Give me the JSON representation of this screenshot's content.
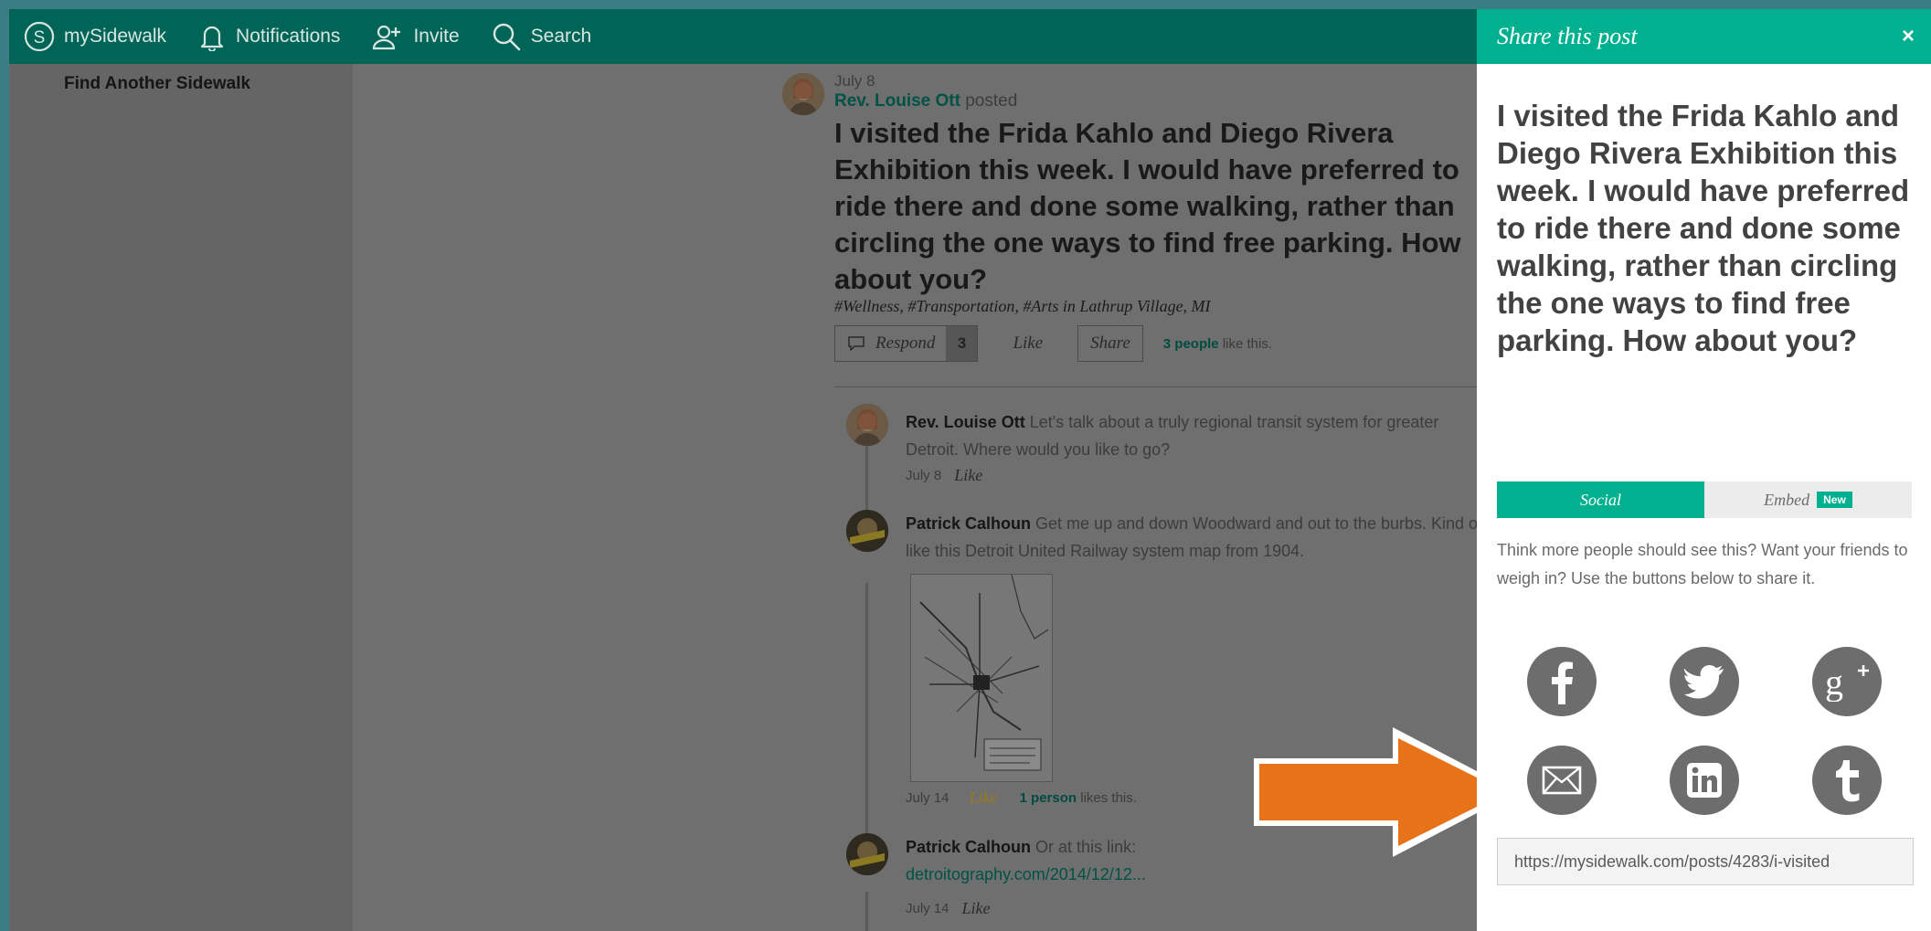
{
  "nav": {
    "brand": "mySidewalk",
    "notifications": "Notifications",
    "invite": "Invite",
    "search": "Search"
  },
  "sidebar": {
    "title": "Find Another Sidewalk"
  },
  "post": {
    "date": "July 8",
    "author": "Rev. Louise Ott",
    "action": "posted",
    "body": "I visited the Frida Kahlo and Diego Rivera Exhibition this week. I would have preferred to ride there and done some walking, rather than circling the one ways to find free parking. How about you?",
    "tags_text": "#Wellness, #Transportation, #Arts",
    "location_prefix": "in",
    "location": "Lathrup Village, MI",
    "respond_label": "Respond",
    "respond_count": "3",
    "like_label": "Like",
    "share_label": "Share",
    "likes_count": "3 people",
    "likes_suffix": "like this."
  },
  "comments": [
    {
      "author": "Rev. Louise Ott",
      "text": "Let's talk about a truly regional transit system for greater Detroit. Where would you like to go?",
      "date": "July 8",
      "like_label": "Like"
    },
    {
      "author": "Patrick Calhoun",
      "text": "Get me up and down Woodward and out to the burbs. Kind of like this Detroit United Railway system map from 1904.",
      "date": "July 14",
      "like_label": "Like",
      "likes_count": "1 person",
      "likes_suffix": "likes this."
    },
    {
      "author": "Patrick Calhoun",
      "text": "Or at this link:",
      "link": "detroitography.com/2014/12/12...",
      "date": "July 14",
      "like_label": "Like"
    }
  ],
  "share_panel": {
    "title": "Share this post",
    "close": "×",
    "post_text": "I visited the Frida Kahlo and Diego Rivera Exhibition this week. I would have preferred to ride there and done some walking, rather than circling the one ways to find free parking. How about you?",
    "tabs": {
      "social": "Social",
      "embed": "Embed",
      "new_badge": "New"
    },
    "description": "Think more people should see this? Want your friends to weigh in? Use the buttons below to share it.",
    "url": "https://mysidewalk.com/posts/4283/i-visited",
    "buttons": [
      "facebook-icon",
      "twitter-icon",
      "google-plus-icon",
      "email-icon",
      "linkedin-icon",
      "tumblr-icon"
    ]
  },
  "colors": {
    "nav_bg": "#006556",
    "accent": "#00b08f",
    "overlay_bg": "#6f6f6f",
    "arrow": "#e8721a"
  }
}
